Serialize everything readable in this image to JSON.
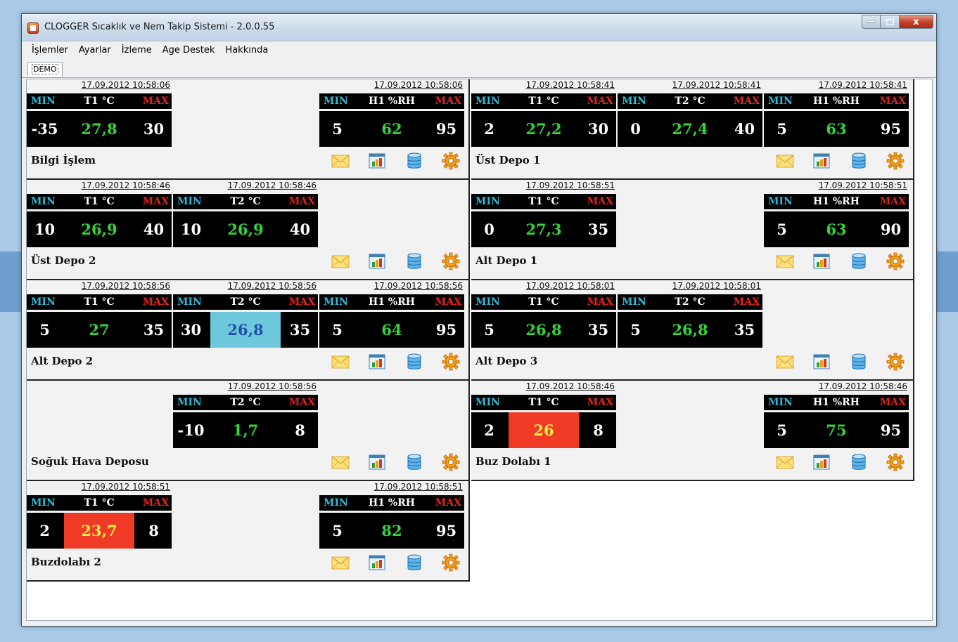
{
  "window": {
    "title": "CLOGGER Sıcaklık ve Nem Takip Sistemi - 2.0.0.55",
    "close_glyph": "x"
  },
  "menu": [
    "İşlemler",
    "Ayarlar",
    "İzleme",
    "Age Destek",
    "Hakkında"
  ],
  "tab": "DEMO",
  "labels": {
    "min": "MIN",
    "max": "MAX"
  },
  "icon_names": [
    "mail-icon",
    "chart-icon",
    "database-icon",
    "settings-gear-icon"
  ],
  "colors": {
    "header_min": "#35b8d6",
    "header_max": "#e3241f",
    "value_normal": "#33d63a",
    "value_low_bg": "#6ec8dc",
    "value_low_text": "#1c52a5",
    "value_high_bg": "#ef3a25",
    "value_high_text": "#fff24a"
  },
  "panels": [
    {
      "name": "Bilgi İşlem",
      "sensors": [
        {
          "timestamp": "17.09.2012 10:58:06",
          "label": "T1 °C",
          "min": "-35",
          "value": "27,8",
          "max": "30",
          "state": "normal"
        },
        null,
        {
          "timestamp": "17.09.2012 10:58:06",
          "label": "H1 %RH",
          "min": "5",
          "value": "62",
          "max": "95",
          "state": "normal"
        }
      ]
    },
    {
      "name": "Üst Depo 1",
      "sensors": [
        {
          "timestamp": "17.09.2012 10:58:41",
          "label": "T1 °C",
          "min": "2",
          "value": "27,2",
          "max": "30",
          "state": "normal"
        },
        {
          "timestamp": "17.09.2012 10:58:41",
          "label": "T2 °C",
          "min": "0",
          "value": "27,4",
          "max": "40",
          "state": "normal"
        },
        {
          "timestamp": "17.09.2012 10:58:41",
          "label": "H1 %RH",
          "min": "5",
          "value": "63",
          "max": "95",
          "state": "normal"
        }
      ]
    },
    {
      "name": "Üst Depo 2",
      "sensors": [
        {
          "timestamp": "17.09.2012 10:58:46",
          "label": "T1 °C",
          "min": "10",
          "value": "26,9",
          "max": "40",
          "state": "normal"
        },
        {
          "timestamp": "17.09.2012 10:58:46",
          "label": "T2 °C",
          "min": "10",
          "value": "26,9",
          "max": "40",
          "state": "normal"
        },
        null
      ]
    },
    {
      "name": "Alt Depo 1",
      "sensors": [
        {
          "timestamp": "17.09.2012 10:58:51",
          "label": "T1 °C",
          "min": "0",
          "value": "27,3",
          "max": "35",
          "state": "normal"
        },
        null,
        {
          "timestamp": "17.09.2012 10:58:51",
          "label": "H1 %RH",
          "min": "5",
          "value": "63",
          "max": "90",
          "state": "normal"
        }
      ]
    },
    {
      "name": "Alt Depo 2",
      "sensors": [
        {
          "timestamp": "17.09.2012 10:58:56",
          "label": "T1 °C",
          "min": "5",
          "value": "27",
          "max": "35",
          "state": "normal"
        },
        {
          "timestamp": "17.09.2012 10:58:56",
          "label": "T2 °C",
          "min": "30",
          "value": "26,8",
          "max": "35",
          "state": "low"
        },
        {
          "timestamp": "17.09.2012 10:58:56",
          "label": "H1 %RH",
          "min": "5",
          "value": "64",
          "max": "95",
          "state": "normal"
        }
      ]
    },
    {
      "name": "Alt Depo 3",
      "sensors": [
        {
          "timestamp": "17.09.2012 10:58:01",
          "label": "T1 °C",
          "min": "5",
          "value": "26,8",
          "max": "35",
          "state": "normal"
        },
        {
          "timestamp": "17.09.2012 10:58:01",
          "label": "T2 °C",
          "min": "5",
          "value": "26,8",
          "max": "35",
          "state": "normal"
        },
        null
      ]
    },
    {
      "name": "Soğuk Hava Deposu",
      "sensors": [
        null,
        {
          "timestamp": "17.09.2012 10:58:56",
          "label": "T2 °C",
          "min": "-10",
          "value": "1,7",
          "max": "8",
          "state": "normal"
        },
        null
      ]
    },
    {
      "name": "Buz Dolabı 1",
      "sensors": [
        {
          "timestamp": "17.09.2012 10:58:46",
          "label": "T1 °C",
          "min": "2",
          "value": "26",
          "max": "8",
          "state": "high"
        },
        null,
        {
          "timestamp": "17.09.2012 10:58:46",
          "label": "H1 %RH",
          "min": "5",
          "value": "75",
          "max": "95",
          "state": "normal"
        }
      ]
    },
    {
      "name": "Buzdolabı 2",
      "sensors": [
        {
          "timestamp": "17.09.2012 10:58:51",
          "label": "T1 °C",
          "min": "2",
          "value": "23,7",
          "max": "8",
          "state": "high"
        },
        null,
        {
          "timestamp": "17.09.2012 10:58:51",
          "label": "H1 %RH",
          "min": "5",
          "value": "82",
          "max": "95",
          "state": "normal"
        }
      ]
    }
  ]
}
